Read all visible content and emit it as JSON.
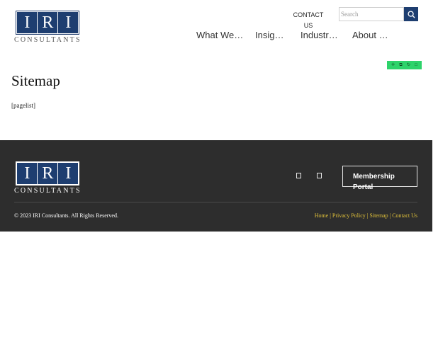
{
  "header": {
    "logo": {
      "letters": [
        "I",
        "R",
        "I"
      ],
      "tagline": "CONSULTANTS"
    },
    "contact_link": "CONTACT US",
    "search": {
      "placeholder": "Search"
    },
    "nav": [
      "What We…",
      "Insig…",
      "Industr…",
      "About …"
    ]
  },
  "edit_toolbar": {
    "icons": [
      "move-icon",
      "copy-icon",
      "refresh-icon",
      "square-icon"
    ]
  },
  "main": {
    "title": "Sitemap",
    "shortcode": "[pagelist]"
  },
  "footer": {
    "logo": {
      "letters": [
        "I",
        "R",
        "I"
      ],
      "tagline": "CONSULTANTS"
    },
    "social_icons": [
      "social-icon-1",
      "social-icon-2"
    ],
    "membership_button": "Membership Portal",
    "copyright": "© 2023 IRI Consultants. All Rights Reserved.",
    "links": [
      "Home",
      "Privacy Policy",
      "Sitemap",
      "Contact Us"
    ]
  },
  "colors": {
    "brand_navy": "#1e3e70",
    "footer_bg": "#2d2d2d",
    "footer_link": "#e2c23a",
    "edit_toolbar": "#2ed36b"
  }
}
